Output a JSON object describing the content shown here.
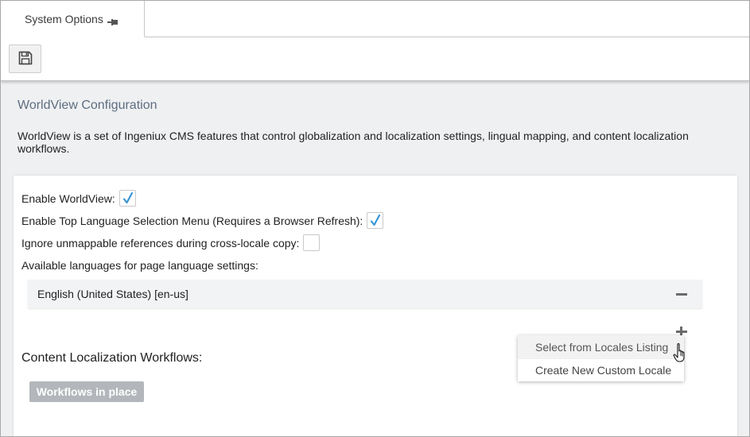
{
  "tabs": {
    "active_label": "System Options",
    "pin_icon": "pin-icon"
  },
  "toolbar": {
    "save_icon": "save-icon"
  },
  "page": {
    "title": "WorldView Configuration",
    "description": "WorldView is a set of Ingeniux CMS features that control globalization and localization settings, lingual mapping, and content localization workflows."
  },
  "options": {
    "enable_worldview_label": "Enable WorldView:",
    "enable_worldview_checked": true,
    "enable_top_menu_label": "Enable Top Language Selection Menu (Requires a Browser Refresh):",
    "enable_top_menu_checked": true,
    "ignore_unmappable_label": "Ignore unmappable references during cross-locale copy:",
    "ignore_unmappable_checked": false,
    "available_languages_label": "Available languages for page language settings:"
  },
  "languages": [
    {
      "label": "English (United States) [en-us]"
    }
  ],
  "workflows": {
    "section_label": "Content Localization Workflows:",
    "button_label": "Workflows in place"
  },
  "add_menu": {
    "items": [
      {
        "label": "Select from Locales Listing",
        "hovered": true
      },
      {
        "label": "Create New Custom Locale",
        "hovered": false
      }
    ]
  },
  "colors": {
    "accent_check": "#3a96d6",
    "title": "#5e6e80",
    "disabled_button": "#b3b7bb"
  }
}
